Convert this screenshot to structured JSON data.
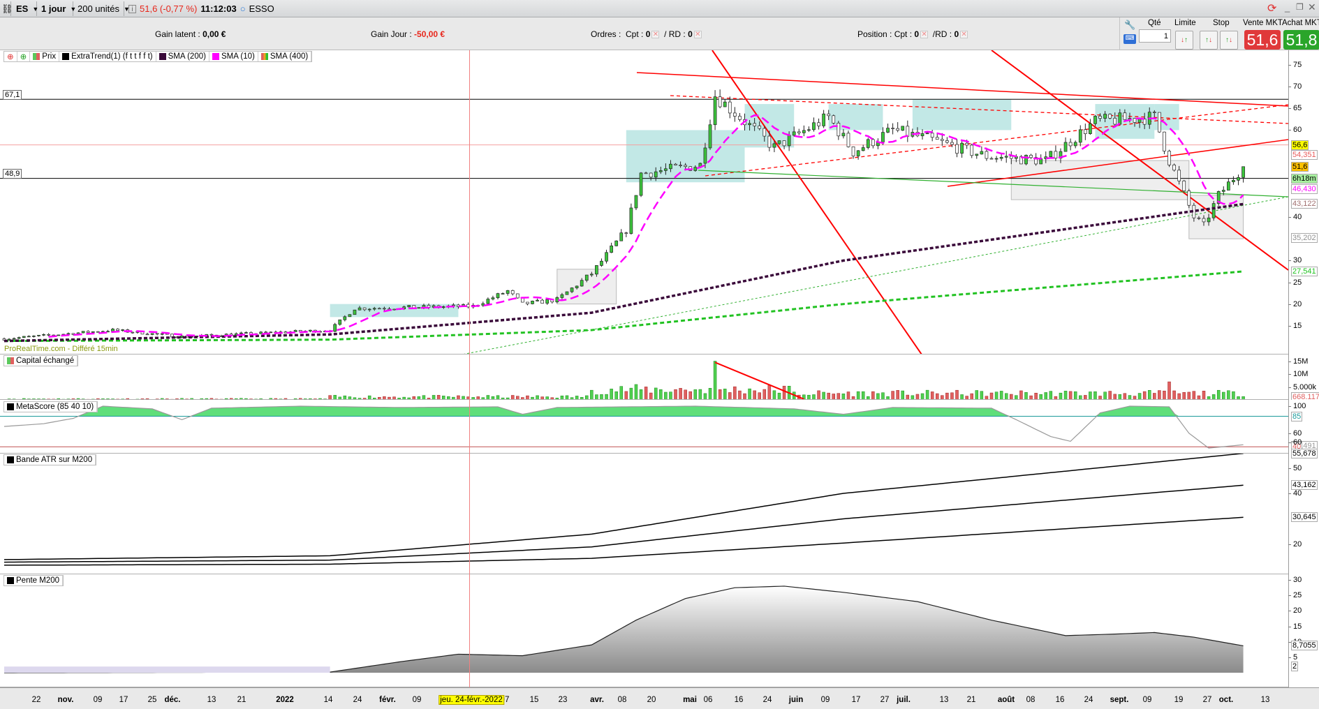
{
  "toolbar": {
    "symbol": "ES",
    "timeframe": "1 jour",
    "units": "200 unités",
    "quote": "51,6 (-0,77 %)",
    "time": "11:12:03",
    "exchange": "ESSO",
    "icons": [
      "link-icon",
      "info-icon",
      "refresh-icon",
      "minimize-icon",
      "restore-icon",
      "close-icon"
    ]
  },
  "infobar": {
    "gain_latent_label": "Gain latent :",
    "gain_latent_value": "0,00 €",
    "gain_jour_label": "Gain Jour :",
    "gain_jour_value": "-50,00 €",
    "ordres_label": "Ordres :",
    "cpt_label": "Cpt :",
    "cpt_value": "0",
    "rd_label": "/ RD :",
    "rd_value": "0",
    "position_label": "Position :",
    "pos_cpt_label": "Cpt :",
    "pos_cpt_value": "0",
    "pos_rd_label": "/RD :",
    "pos_rd_value": "0"
  },
  "orders": {
    "qty_label": "Qté",
    "qty_value": "1",
    "limit_label": "Limite",
    "stop_label": "Stop",
    "sell_label": "Vente MKT",
    "sell_price": "51,6",
    "buy_label": "Achat MKT",
    "buy_price": "51,8",
    "sell_color": "#e0393a",
    "buy_color": "#2aa52a"
  },
  "price_panel": {
    "legend": [
      "Prix",
      "ExtraTrend(1) (f t t f f t)",
      "SMA (200)",
      "SMA (10)",
      "SMA (400)"
    ],
    "source": "ProRealTime.com - Différé 15min",
    "levels": [
      "67,1",
      "48,9"
    ],
    "ticks": [
      75,
      70,
      65,
      60,
      40,
      30,
      25,
      20,
      15
    ],
    "tags": [
      {
        "v": 56.6,
        "text": "56,6",
        "bg": "#ffff00",
        "fg": "#000"
      },
      {
        "v": 54.351,
        "text": "54,351",
        "bg": "#fff",
        "fg": "#e85a5a"
      },
      {
        "v": 51.6,
        "text": "51,6",
        "bg": "#ffc000",
        "fg": "#000"
      },
      {
        "v": 48.9,
        "text": "6h18m",
        "bg": "#a8f0a0",
        "fg": "#000"
      },
      {
        "v": 46.43,
        "text": "46,430",
        "bg": "#fff",
        "fg": "#ff00ff"
      },
      {
        "v": 43.122,
        "text": "43,122",
        "bg": "#fff",
        "fg": "#a07070"
      },
      {
        "v": 35.202,
        "text": "35,202",
        "bg": "#fff",
        "fg": "#909090"
      },
      {
        "v": 27.541,
        "text": "27,541",
        "bg": "#fff",
        "fg": "#1ec21e"
      }
    ],
    "path": [
      [
        0,
        12
      ],
      [
        22,
        14
      ],
      [
        36,
        12.5
      ],
      [
        66,
        14
      ],
      [
        71,
        19
      ],
      [
        95,
        19.5
      ],
      [
        102,
        23
      ],
      [
        105,
        20
      ],
      [
        112,
        21
      ],
      [
        119,
        27
      ],
      [
        126,
        37
      ],
      [
        129,
        50
      ],
      [
        141,
        52
      ],
      [
        144,
        68
      ],
      [
        150,
        62
      ],
      [
        156,
        56
      ],
      [
        167,
        63
      ],
      [
        172,
        55
      ],
      [
        180,
        60
      ],
      [
        187,
        58
      ],
      [
        199,
        54
      ],
      [
        211,
        53
      ],
      [
        221,
        62
      ],
      [
        233,
        63
      ],
      [
        236,
        53
      ],
      [
        241,
        40
      ],
      [
        243,
        38
      ],
      [
        246,
        45
      ],
      [
        251,
        51.6
      ]
    ],
    "sma200": [
      [
        0,
        11.5
      ],
      [
        66,
        13
      ],
      [
        119,
        18
      ],
      [
        170,
        30
      ],
      [
        251,
        43
      ]
    ],
    "sma400": [
      [
        0,
        11.5
      ],
      [
        66,
        11.8
      ],
      [
        119,
        14
      ],
      [
        170,
        20
      ],
      [
        251,
        27.5
      ]
    ]
  },
  "volume_panel": {
    "title": "Capital échangé",
    "ticks": [
      {
        "v": 15,
        "text": "15M"
      },
      {
        "v": 10,
        "text": "10M"
      },
      {
        "v": 5,
        "text": "5.000k"
      }
    ],
    "tag": "668.117"
  },
  "metascore_panel": {
    "title": "MetaScore (85 40 10)",
    "ticks": [
      {
        "v": 100,
        "text": "100"
      },
      {
        "v": 60,
        "text": "60"
      }
    ],
    "tags": [
      {
        "v": 85,
        "text": "85",
        "fg": "#1a9a9a"
      },
      {
        "v": 41.491,
        "text": "41,491",
        "fg": "#999"
      },
      {
        "v": 40,
        "text": "40",
        "fg": "#e06060"
      }
    ],
    "path": [
      [
        0,
        70
      ],
      [
        8,
        74
      ],
      [
        14,
        82
      ],
      [
        20,
        100
      ],
      [
        30,
        96
      ],
      [
        36,
        80
      ],
      [
        42,
        97
      ],
      [
        60,
        100
      ],
      [
        80,
        98
      ],
      [
        100,
        99
      ],
      [
        105,
        88
      ],
      [
        112,
        98
      ],
      [
        140,
        100
      ],
      [
        160,
        96
      ],
      [
        170,
        88
      ],
      [
        180,
        98
      ],
      [
        200,
        97
      ],
      [
        205,
        80
      ],
      [
        212,
        55
      ],
      [
        216,
        48
      ],
      [
        222,
        90
      ],
      [
        228,
        100
      ],
      [
        236,
        99
      ],
      [
        240,
        60
      ],
      [
        244,
        38
      ],
      [
        251,
        43
      ]
    ]
  },
  "atr_panel": {
    "title": "Bande ATR sur M200",
    "ticks": [
      {
        "v": 60,
        "text": "60"
      },
      {
        "v": 50,
        "text": "50"
      },
      {
        "v": 40,
        "text": "40"
      },
      {
        "v": 20,
        "text": "20"
      }
    ],
    "tags": [
      {
        "v": 55.678,
        "text": "55,678"
      },
      {
        "v": 43.162,
        "text": "43,162"
      },
      {
        "v": 30.645,
        "text": "30,645"
      }
    ],
    "upper": [
      [
        0,
        14
      ],
      [
        66,
        15.5
      ],
      [
        119,
        24
      ],
      [
        170,
        40
      ],
      [
        251,
        55.7
      ]
    ],
    "middle": [
      [
        0,
        13
      ],
      [
        66,
        13.8
      ],
      [
        119,
        19
      ],
      [
        170,
        30
      ],
      [
        251,
        43.2
      ]
    ],
    "lower": [
      [
        0,
        11.8
      ],
      [
        66,
        12.2
      ],
      [
        119,
        14.5
      ],
      [
        170,
        20.5
      ],
      [
        251,
        30.6
      ]
    ]
  },
  "pente_panel": {
    "title": "Pente M200",
    "ticks": [
      30,
      25,
      20,
      15,
      10,
      5
    ],
    "tags": [
      {
        "v": 8.7055,
        "text": "8,7055"
      },
      {
        "v": 2,
        "text": "2"
      }
    ],
    "path": [
      [
        0,
        0
      ],
      [
        66,
        0.2
      ],
      [
        80,
        3.5
      ],
      [
        92,
        6
      ],
      [
        105,
        5.5
      ],
      [
        119,
        9
      ],
      [
        128,
        17
      ],
      [
        138,
        24
      ],
      [
        148,
        27.5
      ],
      [
        158,
        28
      ],
      [
        170,
        26
      ],
      [
        185,
        23
      ],
      [
        200,
        17
      ],
      [
        215,
        12
      ],
      [
        225,
        12.5
      ],
      [
        233,
        13
      ],
      [
        241,
        11.5
      ],
      [
        251,
        8.7
      ]
    ]
  },
  "date_axis": {
    "labels": [
      "22",
      "nov.",
      "09",
      "17",
      "25",
      "déc.",
      "13",
      "21",
      "2022",
      "14",
      "24",
      "févr.",
      "09",
      "07",
      "15",
      "23",
      "avr.",
      "08",
      "20",
      "mai",
      "06",
      "16",
      "24",
      "juin",
      "09",
      "17",
      "27",
      "juil.",
      "13",
      "21",
      "août",
      "08",
      "16",
      "24",
      "sept.",
      "09",
      "19",
      "27",
      "oct.",
      "13"
    ],
    "cursor": "jeu. 24-févr.-2022"
  }
}
